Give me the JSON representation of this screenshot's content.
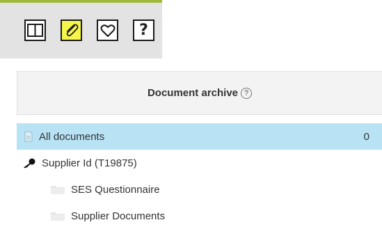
{
  "toolbar": {
    "buttons": [
      {
        "icon": "split-view-icon",
        "active": false
      },
      {
        "icon": "paperclip-icon",
        "active": true
      },
      {
        "icon": "heart-icon",
        "active": false
      },
      {
        "icon": "help-icon",
        "label": "?",
        "active": false
      }
    ],
    "accent_color": "#9fba3b",
    "active_color": "#f6f64a"
  },
  "archive": {
    "title": "Document archive",
    "help_label": "?",
    "all_documents": {
      "label": "All documents",
      "count": "0",
      "highlight_color": "#b8e3f5"
    },
    "supplier": {
      "label": "Supplier Id (T19875)",
      "icon": "key-icon"
    },
    "folders": [
      {
        "label": "SES Questionnaire",
        "icon": "folder-icon"
      },
      {
        "label": "Supplier Documents",
        "icon": "folder-icon"
      }
    ]
  }
}
